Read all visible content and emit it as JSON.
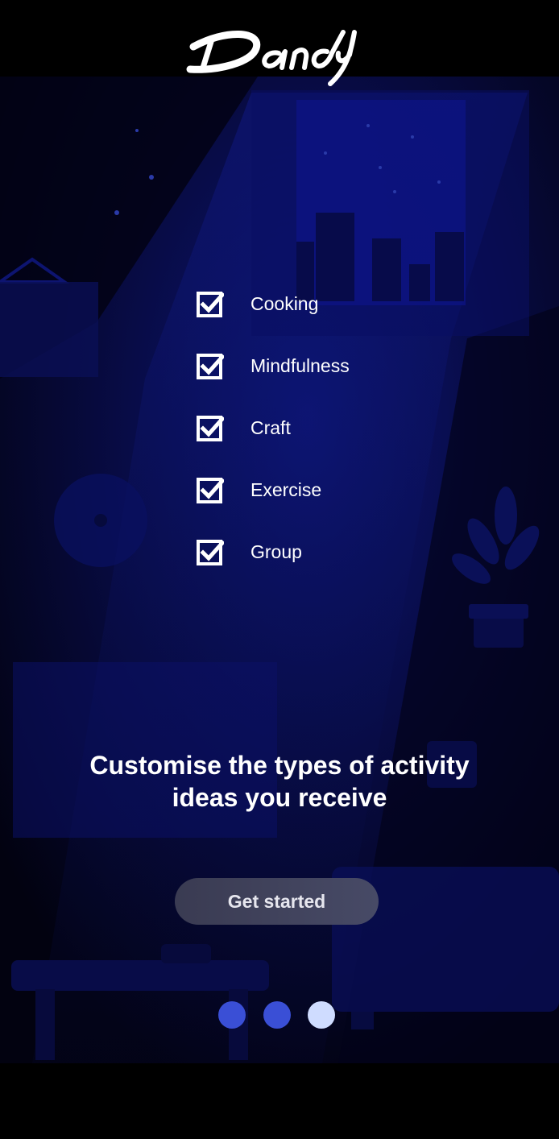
{
  "app": {
    "brand": "Dandy"
  },
  "activities": {
    "items": [
      {
        "label": "Cooking",
        "checked": true
      },
      {
        "label": "Mindfulness",
        "checked": true
      },
      {
        "label": "Craft",
        "checked": true
      },
      {
        "label": "Exercise",
        "checked": true
      },
      {
        "label": "Group",
        "checked": true
      }
    ]
  },
  "onboarding": {
    "headline_line1": "Customise the types of activity",
    "headline_line2": "ideas you receive",
    "cta_label": "Get started"
  },
  "pager": {
    "total": 3,
    "active_index": 2
  },
  "colors": {
    "background": "#000000",
    "scene_blue": "#0b0f5c",
    "dot_inactive": "#3a4fd6",
    "dot_active": "#cfdcff",
    "button_bg": "#3c3e56",
    "text": "#ffffff"
  }
}
